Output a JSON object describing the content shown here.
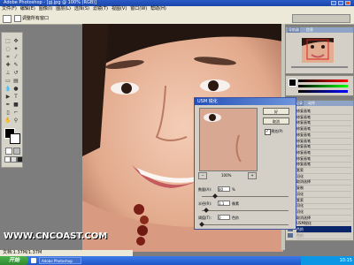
{
  "app": {
    "title": "Adobe Photoshop - [gj.jpg @ 100% (RGB)]",
    "menu": [
      "文件(F)",
      "编辑(E)",
      "图像(I)",
      "图层(L)",
      "选择(S)",
      "滤镜(T)",
      "视图(V)",
      "窗口(W)",
      "帮助(H)"
    ],
    "options_label": "调整所有窗口",
    "doc_status": "文档:1.37M/1.37M"
  },
  "panels": {
    "navigator_tabs": [
      "导航器",
      "信息"
    ],
    "history_tabs": [
      "历史记录",
      "动作"
    ],
    "history_items": [
      "修复画笔",
      "修复画笔",
      "修复画笔",
      "修复画笔",
      "修复画笔",
      "修复画笔",
      "修复画笔",
      "修复画笔",
      "修复画笔",
      "修复画笔",
      "套索",
      "羽化",
      "取消选择",
      "复制",
      "羽化",
      "套索",
      "羽化",
      "羽化",
      "取消选择",
      "USM锐化",
      "色阶",
      "色阶"
    ]
  },
  "dialog": {
    "title": "USM 锐化",
    "ok_label": "好",
    "cancel_label": "取消",
    "preview_label": "预览(P)",
    "zoom": "100%",
    "amount_label": "数量(A):",
    "amount_value": "80",
    "amount_unit": "%",
    "radius_label": "半径(R):",
    "radius_value": "1.1",
    "radius_unit": "像素",
    "threshold_label": "阈值(T):",
    "threshold_value": "0",
    "threshold_unit": "色阶",
    "amount_fraction": 0.16,
    "radius_fraction": 0.05,
    "threshold_fraction": 0.0
  },
  "watermark": "WWW.CNCOAST.COM",
  "taskbar": {
    "start": "开始",
    "item": "Adobe Photoshop",
    "clock": "10:15"
  },
  "colors": {
    "accent": "#2a5cc8",
    "panel": "#d4d0c8",
    "history_selected": "#0a246a"
  }
}
